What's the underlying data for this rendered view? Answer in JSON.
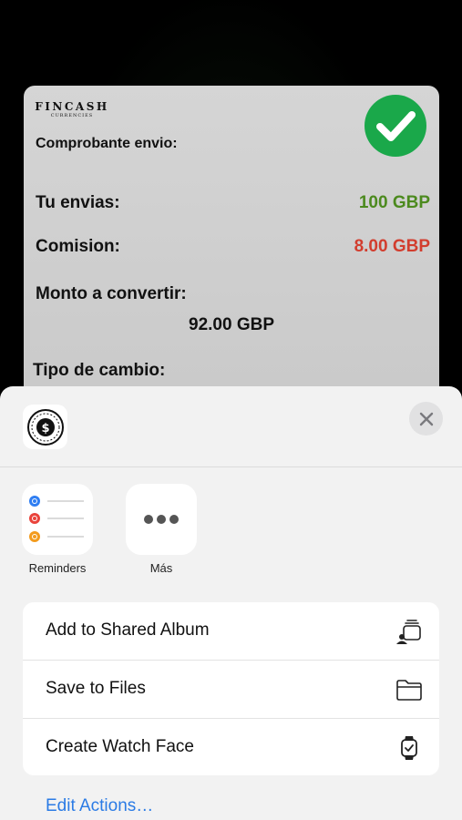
{
  "receipt": {
    "brand_name": "FINCASH",
    "brand_sub": "CURRENCIES",
    "title": "Comprobante envio:",
    "sent_label": "Tu envias:",
    "sent_value": "100 GBP",
    "fee_label": "Comision:",
    "fee_value": "8.00 GBP",
    "convert_label": "Monto a convertir:",
    "convert_value": "92.00 GBP",
    "rate_label": "Tipo de cambio:",
    "colors": {
      "sent": "#4c8a1e",
      "fee": "#d23d2e",
      "check": "#1aa84a"
    }
  },
  "share_sheet": {
    "apps": [
      {
        "label": "Reminders",
        "icon": "reminders-icon"
      },
      {
        "label": "Más",
        "icon": "more-icon"
      }
    ],
    "actions": [
      {
        "label": "Add to Shared Album",
        "icon": "shared-album-icon"
      },
      {
        "label": "Save to Files",
        "icon": "folder-icon"
      },
      {
        "label": "Create Watch Face",
        "icon": "watch-icon"
      }
    ],
    "edit_actions": "Edit Actions…",
    "accent": "#2b7be5"
  }
}
